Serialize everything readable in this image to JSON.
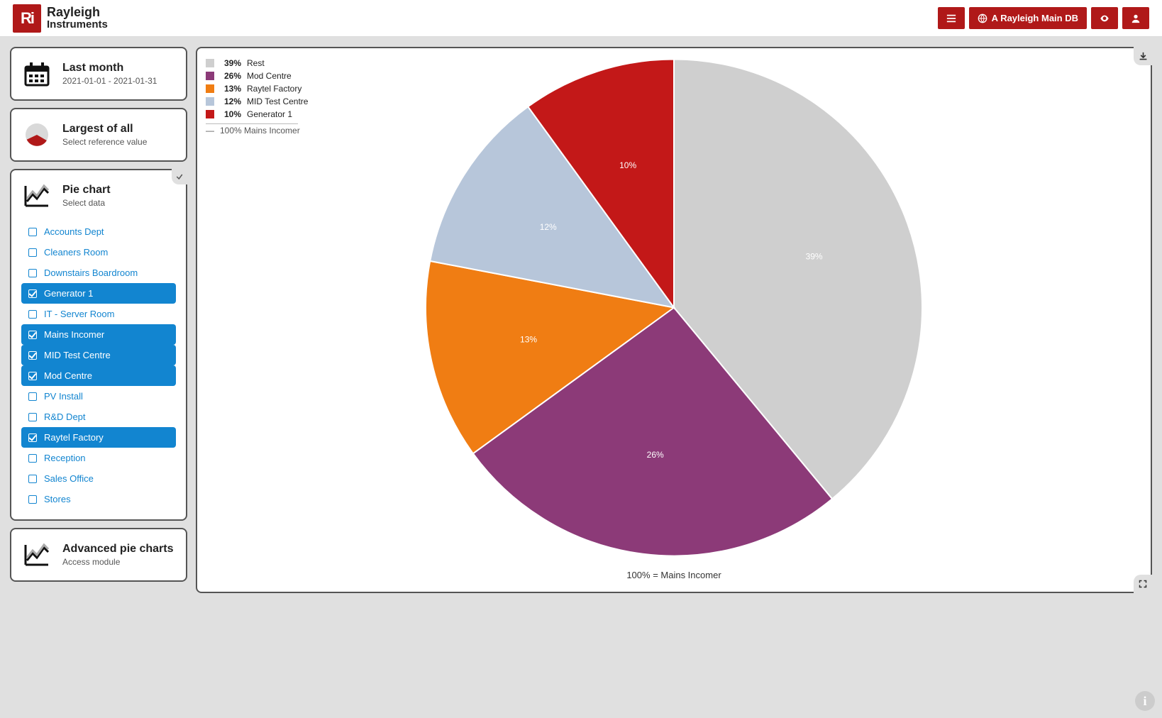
{
  "brand": {
    "line1": "Rayleigh",
    "line2": "Instruments",
    "mark": "Ri"
  },
  "topbar": {
    "db_label": "A Rayleigh Main DB"
  },
  "cards": {
    "date": {
      "title": "Last month",
      "sub": "2021-01-01 - 2021-01-31"
    },
    "ref": {
      "title": "Largest of all",
      "sub": "Select reference value"
    },
    "pie": {
      "title": "Pie chart",
      "sub": "Select data"
    },
    "adv": {
      "title": "Advanced pie charts",
      "sub": "Access module"
    }
  },
  "data_selectors": [
    {
      "label": "Accounts Dept",
      "checked": false
    },
    {
      "label": "Cleaners Room",
      "checked": false
    },
    {
      "label": "Downstairs Boardroom",
      "checked": false
    },
    {
      "label": "Generator 1",
      "checked": true
    },
    {
      "label": "IT - Server Room",
      "checked": false
    },
    {
      "label": "Mains Incomer",
      "checked": true
    },
    {
      "label": "MID Test Centre",
      "checked": true
    },
    {
      "label": "Mod Centre",
      "checked": true
    },
    {
      "label": "PV Install",
      "checked": false
    },
    {
      "label": "R&D Dept",
      "checked": false
    },
    {
      "label": "Raytel Factory",
      "checked": true
    },
    {
      "label": "Reception",
      "checked": false
    },
    {
      "label": "Sales Office",
      "checked": false
    },
    {
      "label": "Stores",
      "checked": false
    }
  ],
  "chart_data": {
    "type": "pie",
    "title": "",
    "reference_label": "100% Mains Incomer",
    "caption": "100% = Mains Incomer",
    "series": [
      {
        "name": "Rest",
        "value": 39,
        "color": "#cfcfcf"
      },
      {
        "name": "Mod Centre",
        "value": 26,
        "color": "#8c3a78"
      },
      {
        "name": "Raytel Factory",
        "value": 13,
        "color": "#f07d13"
      },
      {
        "name": "MID Test Centre",
        "value": 12,
        "color": "#b7c6da"
      },
      {
        "name": "Generator 1",
        "value": 10,
        "color": "#c31818"
      }
    ]
  }
}
